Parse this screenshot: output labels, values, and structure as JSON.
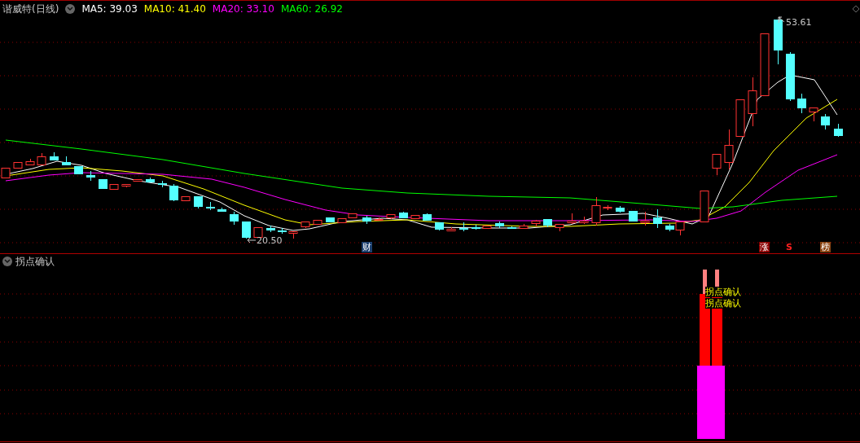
{
  "main_pane": {
    "title": "谐威特(日线)",
    "ma_legend": [
      {
        "label": "MA5: 39.03",
        "color": "#ffffff"
      },
      {
        "label": "MA10: 41.40",
        "color": "#ffff00"
      },
      {
        "label": "MA20: 33.10",
        "color": "#ff00ff"
      },
      {
        "label": "MA60: 26.92",
        "color": "#00ff00"
      }
    ],
    "high_label": "53.61",
    "low_label": "20.50",
    "event_marks": [
      {
        "text": "财",
        "kind": "badge",
        "color": "#1c3f6e"
      },
      {
        "text": "涨",
        "kind": "badge",
        "color": "#8b0000"
      },
      {
        "text": "S",
        "kind": "plain",
        "color": "#ff2020"
      },
      {
        "text": "榜",
        "kind": "badge",
        "color": "#8b4513"
      }
    ]
  },
  "indicator_pane": {
    "title": "拐点确认",
    "signal_labels": [
      "拐点确认",
      "拐点确认"
    ]
  }
}
